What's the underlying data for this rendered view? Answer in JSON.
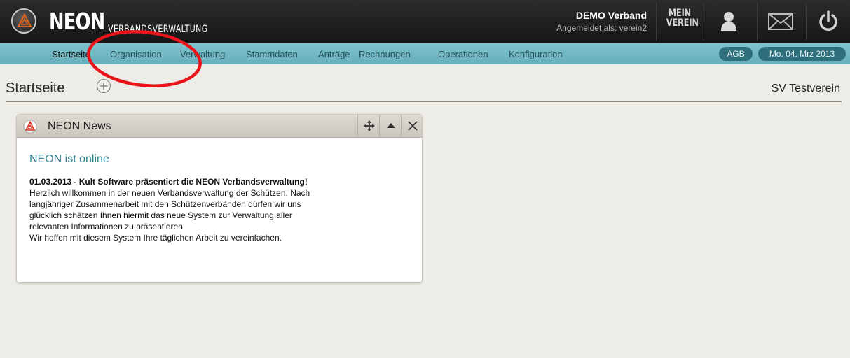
{
  "header": {
    "brand": "NEON",
    "brand_sub": "VERBANDSVERWALTUNG",
    "org_name": "DEMO Verband",
    "login_info": "Angemeldet als: verein2",
    "mein_verein_line1": "MEIN",
    "mein_verein_line2": "VEREIN",
    "icons": [
      "neon-logo-icon",
      "user-icon",
      "mail-icon",
      "power-icon"
    ]
  },
  "nav": {
    "items": [
      {
        "label": "Startseite"
      },
      {
        "label": "Organisation"
      },
      {
        "label": "Verwaltung"
      },
      {
        "label": "Stammdaten"
      },
      {
        "label": "Anträge"
      },
      {
        "label": "Rechnungen"
      },
      {
        "label": "Operationen"
      },
      {
        "label": "Konfiguration"
      }
    ],
    "active_index": 0,
    "agb_label": "AGB",
    "date_label": "Mo. 04. Mrz 2013"
  },
  "page": {
    "title": "Startseite",
    "club_name": "SV Testverein"
  },
  "widget": {
    "title": "NEON News",
    "heading": "NEON ist online",
    "news_headline": "01.03.2013 - Kult Software präsentiert die NEON Verbandsverwaltung!",
    "news_lines": [
      "Herzlich willkommen in der neuen Verbandsverwaltung der Schützen. Nach",
      "langjähriger Zusammenarbeit mit den Schützenverbänden dürfen wir uns",
      "glücklich schätzen Ihnen hiermit das neue System zur Verwaltung aller",
      "relevanten Informationen zu präsentieren.",
      "Wir hoffen mit diesem System Ihre täglichen Arbeit zu vereinfachen."
    ]
  },
  "colors": {
    "accent": "#67afbb",
    "header_bg": "#1f1f1f",
    "annotation": "#e8141a",
    "news_heading": "#2a7f8f"
  }
}
